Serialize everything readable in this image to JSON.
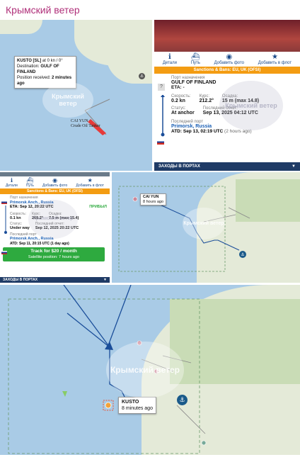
{
  "channel": {
    "title": "Крымский ветер"
  },
  "panel_top_left": {
    "tooltip": {
      "name": "KUSTO [SL]",
      "name_suffix": "at 0 kn / 0°",
      "destination_label": "Destination:",
      "destination": "GULF OF FINLAND",
      "received_label": "Position received:",
      "received": "2 minutes ago"
    },
    "ship_label_name": "CAI YUN",
    "ship_label_type": "Crude Oil Tanker",
    "watermark": "Крымский ветер"
  },
  "panel_top_right": {
    "tabs": [
      {
        "icon": "info-icon",
        "glyph": "ℹ",
        "label": "Детали"
      },
      {
        "icon": "ship-icon",
        "glyph": "⛴",
        "label": "Путь"
      },
      {
        "icon": "camera-icon",
        "glyph": "📷",
        "label": "Добавить фото"
      },
      {
        "icon": "star-icon",
        "glyph": "★",
        "label": "Добавить в флот"
      }
    ],
    "sanctions": "Sanctions & Bans: EU, UK (OFSI)",
    "dest_label": "Порт назначения",
    "dest_value": "GULF OF FINLAND",
    "eta": "ETA: -",
    "speed_label": "Скорость:",
    "speed_value": "0.2 kn",
    "course_label": "Курс:",
    "course_value": "212.2°",
    "draught_label": "Осадка:",
    "draught_value": "15 m (max 14.8)",
    "status_label": "Статус:",
    "status_value": "At anchor",
    "report_label": "Последний отчет:",
    "report_value": "Sep 13, 2025 04:12 UTC",
    "last_port_label": "Последний порт",
    "last_port": "Primorsk, Russia",
    "atd_label": "ATD:",
    "atd": "Sep 13, 02:19 UTC",
    "atd_ago": "(2 hours ago)",
    "footer": "ЗАХОДЫ В ПОРТАХ",
    "question": "?",
    "watermark": "Крымский ветер"
  },
  "panel_mid_left": {
    "tabs": [
      {
        "icon": "info-icon",
        "glyph": "ℹ",
        "label": "Детали"
      },
      {
        "icon": "ship-icon",
        "glyph": "⛴",
        "label": "Путь"
      },
      {
        "icon": "camera-icon",
        "glyph": "📷",
        "label": "Добавить фото"
      },
      {
        "icon": "star-icon",
        "glyph": "★",
        "label": "Добавить в флот"
      }
    ],
    "sanctions": "Sanctions & Bans: EU, UK (OFSI)",
    "dest_label": "Порт назначения",
    "dest_value": "Primorsk Anch., Russia",
    "eta": "ETA: Sep 12, 20:22 UTC",
    "arrived": "ПРИБЫЛ",
    "speed_label": "Скорость:",
    "speed_value": "0.1 kn",
    "course_label": "Курс:",
    "course_value": "269.2°",
    "draught_label": "Осадка:",
    "draught_value": "7.5 m (max 15.4)",
    "status_label": "Статус:",
    "status_value": "Under way",
    "report_label": "Последний отчет:",
    "report_value": "Sep 12, 2025 20:22 UTC",
    "last_port_label": "Последний порт",
    "last_port": "Primorsk Anch., Russia",
    "atd": "ATD: Sep 11, 20:15 UTC (1 day ago)",
    "track_btn": "Track for $20 / month",
    "satellite": "Satellite position: 7 hours ago",
    "footer": "ЗАХОДЫ В ПОРТАХ",
    "watermark": "Крымский ветер"
  },
  "panel_mid_right": {
    "ship_name": "CAI YUN",
    "ship_time": "8 hours ago",
    "watermark": "Крымский ветер"
  },
  "panel_bottom": {
    "ship_name": "KUSTO",
    "ship_time": "8 minutes ago",
    "watermark": "Крымский ветер"
  },
  "colors": {
    "sea": "#a9cbe6",
    "land": "#e4ead8",
    "accent_orange": "#f39c12",
    "brand_magenta": "#b0307a",
    "track_blue": "#1a4d99"
  }
}
